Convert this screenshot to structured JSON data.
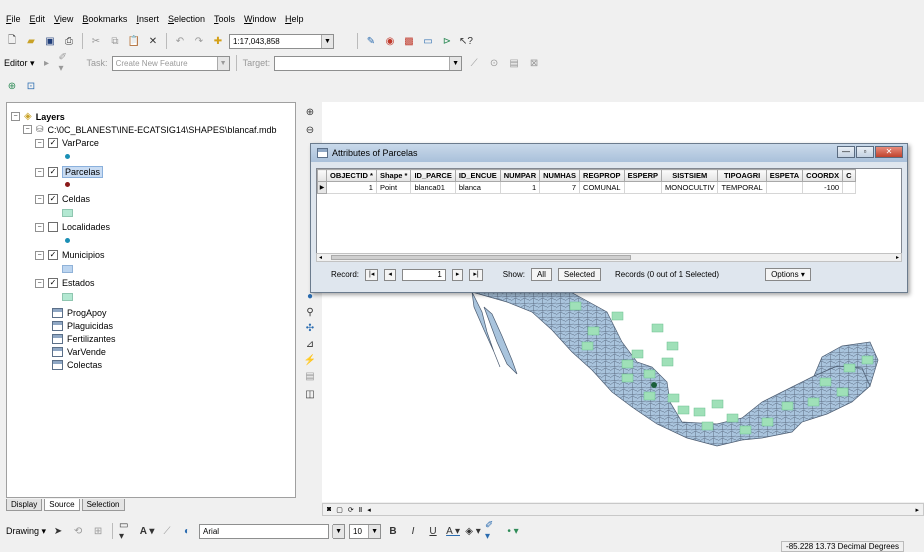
{
  "menu": [
    "File",
    "Edit",
    "View",
    "Bookmarks",
    "Insert",
    "Selection",
    "Tools",
    "Window",
    "Help"
  ],
  "toolbar": {
    "scale": "1:17,043,858",
    "editor_label": "Editor",
    "task_label": "Task:",
    "task_value": "Create New Feature",
    "target_label": "Target:"
  },
  "toc": {
    "root_label": "Layers",
    "mdb_path": "C:\\0C_BLANEST\\INE-ECATSIG14\\SHAPES\\blancaf.mdb",
    "layers": [
      {
        "name": "VarParce",
        "checked": "☑",
        "symbol": "dot",
        "color": "#1a8fb5"
      },
      {
        "name": "Parcelas",
        "checked": "☑",
        "symbol": "dot",
        "color": "#8b1a1a",
        "selected": true
      },
      {
        "name": "Celdas",
        "checked": "☑",
        "symbol": "poly",
        "color": "#b3e8d2"
      },
      {
        "name": "Localidades",
        "checked": "☐",
        "symbol": "dot",
        "color": "#1a8fb5"
      },
      {
        "name": "Municipios",
        "checked": "☑",
        "symbol": "poly",
        "color": "#bcd5f0"
      },
      {
        "name": "Estados",
        "checked": "☑",
        "symbol": "poly",
        "color": "#b3e8d2"
      }
    ],
    "tables": [
      "ProgApoy",
      "Plaguicidas",
      "Fertilizantes",
      "VarVende",
      "Colectas"
    ],
    "tabs": [
      "Display",
      "Source",
      "Selection"
    ]
  },
  "attributes_window": {
    "title": "Attributes of Parcelas",
    "columns": [
      "OBJECTID *",
      "Shape *",
      "ID_PARCE",
      "ID_ENCUE",
      "NUMPAR",
      "NUMHAS",
      "REGPROP",
      "ESPERP",
      "SISTSIEM",
      "TIPOAGRI",
      "ESPETA",
      "COORDX",
      "C"
    ],
    "rows": [
      [
        "1",
        "Point",
        "blanca01",
        "blanca",
        "1",
        "7",
        "COMUNAL",
        "",
        "MONOCULTIV",
        "TEMPORAL",
        "",
        "-100",
        ""
      ]
    ],
    "record_label": "Record:",
    "record_value": "1",
    "show_label": "Show:",
    "show_all": "All",
    "show_selected": "Selected",
    "selection_status": "Records (0 out of 1 Selected)",
    "options_label": "Options"
  },
  "drawing": {
    "label": "Drawing",
    "font": "Arial",
    "font_size": "10"
  },
  "status": {
    "coordinates": "-85.228  13.73 Decimal Degrees"
  },
  "colors": {
    "map_fill": "#a9c4dd",
    "map_border": "#4b5b70",
    "cell_fill": "#9fe0b8"
  }
}
